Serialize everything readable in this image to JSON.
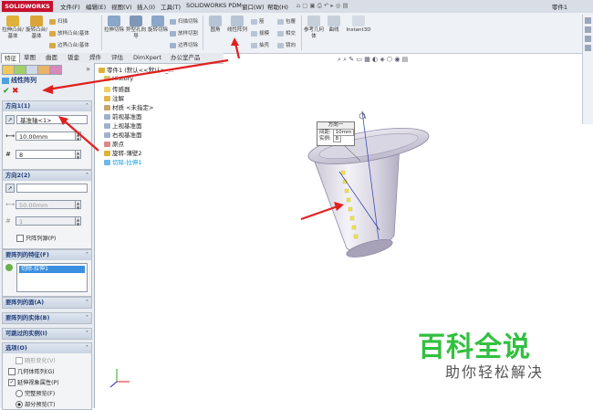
{
  "app": {
    "logo_text": "SOLIDWORKS",
    "document_title": "零件1"
  },
  "menu": [
    "文件(F)",
    "编辑(E)",
    "视图(V)",
    "插入(I)",
    "工具(T)",
    "SOLIDWORKS PDM",
    "窗口(W)",
    "帮助(H)"
  ],
  "ribbon": {
    "big": [
      "拉伸凸台/基体",
      "旋转凸台/基体",
      "拉伸切除",
      "异型孔向导",
      "旋转切除",
      "圆角",
      "线性阵列",
      "参考几何体",
      "曲线",
      "Instant3D"
    ],
    "small": [
      "扫描",
      "放样凸台/基体",
      "边界凸台/基体",
      "扫描切除",
      "放样切割",
      "边界切除",
      "筋",
      "拔模",
      "抽壳",
      "包覆",
      "相交",
      "镜向"
    ]
  },
  "command_tabs": [
    "特征",
    "草图",
    "曲面",
    "钣金",
    "焊件",
    "评估",
    "DimXpert",
    "办公室产品"
  ],
  "property_manager": {
    "title": "线性阵列",
    "direction1": {
      "header": "方向1(1)",
      "reference": "基准轴<1>",
      "spacing": "10.00mm",
      "instances": "8"
    },
    "direction2": {
      "header": "方向2(2)",
      "reference": "",
      "spacing": "50.00mm",
      "instances": "1",
      "only_seed_label": "只阵列源(P)"
    },
    "features_to_pattern": {
      "header": "要阵列的特征(F)",
      "item": "切除-拉伸1"
    },
    "faces_header": "要阵列的面(A)",
    "bodies_header": "要阵列的实体(B)",
    "skip_header": "可跳过的实例(I)",
    "options": {
      "header": "选项(O)",
      "items": [
        "随形变化(V)",
        "几何体阵列(G)",
        "延伸视象属性(P)",
        "完整预览(F)",
        "部分预览(T)"
      ]
    }
  },
  "feature_tree": {
    "root": "零件1 (默认<<默认>_...",
    "items": [
      "History",
      "传感器",
      "注解",
      "材质 <未指定>",
      "前视基准面",
      "上视基准面",
      "右视基准面",
      "原点",
      "旋转-薄壁2",
      "切除-拉伸1"
    ]
  },
  "callout": {
    "title": "方向一",
    "spacing_label": "间距:",
    "spacing_value": "10mm",
    "instances_label": "实例:",
    "instances_value": "8"
  },
  "watermark": {
    "line1": "百科全说",
    "line2": "助你轻松解决"
  },
  "colors": {
    "accent_red": "#e02020",
    "tree_highlight": "#00a0e8",
    "watermark_green": "#32c03f"
  }
}
